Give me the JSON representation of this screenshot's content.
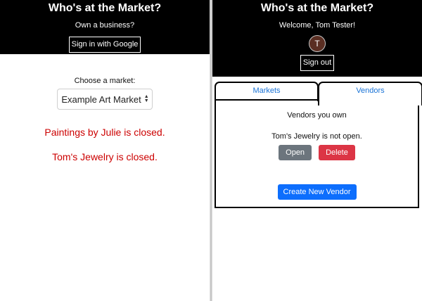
{
  "left": {
    "header": {
      "title": "Who's at the Market?",
      "subtitle": "Own a business?",
      "signin_label": "Sign in with Google"
    },
    "choose_label": "Choose a market:",
    "market_select": {
      "selected": "Example Art Market"
    },
    "statuses": [
      "Paintings by Julie is closed.",
      "Tom's Jewelry is closed."
    ]
  },
  "right": {
    "header": {
      "title": "Who's at the Market?",
      "welcome": "Welcome, Tom Tester!",
      "avatar_initial": "T",
      "signout_label": "Sign out"
    },
    "tabs": [
      {
        "label": "Markets",
        "active": false
      },
      {
        "label": "Vendors",
        "active": true
      }
    ],
    "vendors_heading": "Vendors you own",
    "vendor": {
      "status": "Tom's Jewelry is not open.",
      "open_label": "Open",
      "delete_label": "Delete"
    },
    "create_label": "Create New Vendor"
  },
  "colors": {
    "header_bg": "#000000",
    "closed_text": "#cc0000",
    "link_blue": "#1a73d6",
    "open_button": "#6c757d",
    "delete_button": "#dc3545",
    "create_button": "#0d6efd"
  }
}
